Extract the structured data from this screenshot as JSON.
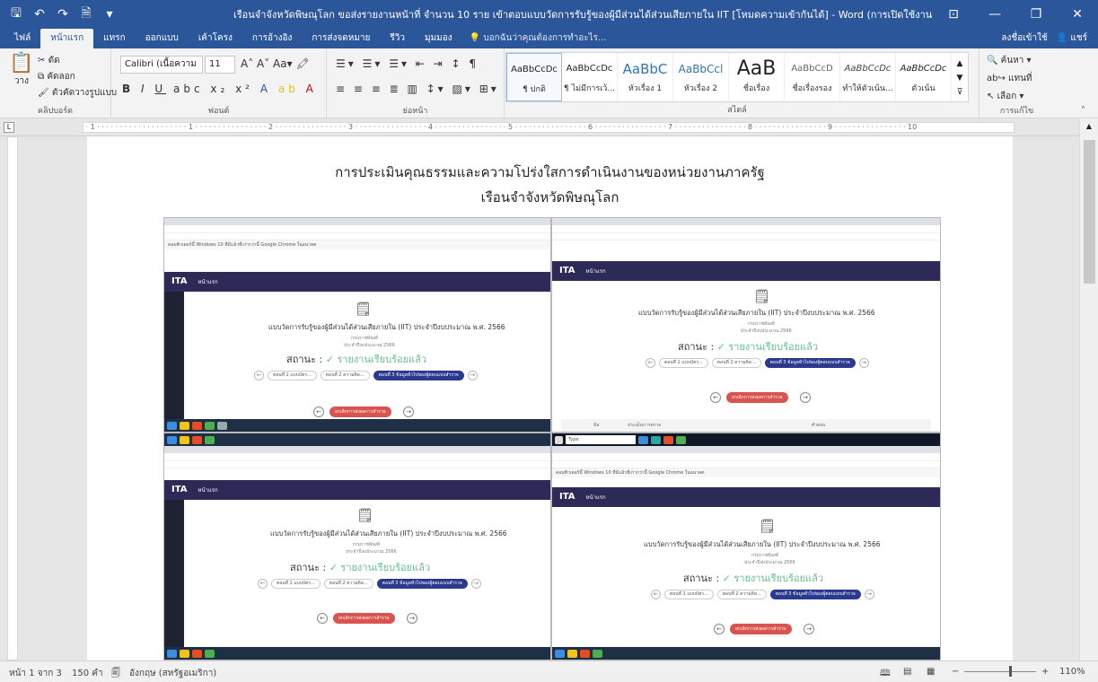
{
  "window": {
    "title": "เรือนจำจังหวัดพิษณุโลก ขอส่งรายงานหน้าที่ จำนวน 10 ราย เข้าตอบแบบวัดการรับรู้ของผู้มีส่วนได้ส่วนเสียภายใน IIT [โหมดความเข้ากันได้] - Word (การเปิดใช้งานผลิตภัณฑ์ล้มเหลว)",
    "minimize": "—",
    "restore": "❐",
    "close": "✕",
    "save_icon": "🖫",
    "undo_icon": "↶",
    "redo_icon": "↷",
    "print_icon": "🗎",
    "more_icon": "▾"
  },
  "tabs": [
    "ไฟล์",
    "หน้าแรก",
    "แทรก",
    "ออกแบบ",
    "เค้าโครง",
    "การอ้างอิง",
    "การส่งจดหมาย",
    "รีวิว",
    "มุมมอง"
  ],
  "tell_me": "บอกฉันว่าคุณต้องการทำอะไร...",
  "signin": "ลงชื่อเข้าใช้",
  "share": "แชร์",
  "ribbon": {
    "clipboard": {
      "label": "คลิปบอร์ด",
      "paste": "วาง",
      "cut": "ตัด",
      "copy": "คัดลอก",
      "format_painter": "ตัวคัดวางรูปแบบ"
    },
    "font": {
      "label": "ฟอนต์",
      "name": "Calibri (เนื้อความ",
      "size": "11"
    },
    "paragraph": {
      "label": "ย่อหน้า"
    },
    "styles": {
      "label": "สไตล์",
      "items": [
        {
          "sample": "AaBbCcDc",
          "name": "¶ ปกติ"
        },
        {
          "sample": "AaBbCcDc",
          "name": "¶ ไม่มีการเว้..."
        },
        {
          "sample": "AaBbC",
          "name": "หัวเรื่อง 1"
        },
        {
          "sample": "AaBbCcl",
          "name": "หัวเรื่อง 2"
        },
        {
          "sample": "AaB",
          "name": "ชื่อเรื่อง"
        },
        {
          "sample": "AaBbCcD",
          "name": "ชื่อเรื่องรอง"
        },
        {
          "sample": "AaBbCcDc",
          "name": "ทำให้ตัวเน้น..."
        },
        {
          "sample": "AaBbCcDc",
          "name": "ตัวเน้น"
        }
      ]
    },
    "editing": {
      "label": "การแก้ไข",
      "find": "ค้นหา",
      "replace": "แทนที่",
      "select": "เลือก"
    }
  },
  "document": {
    "heading_1": "การประเมินคุณธรรมและความโปร่งใสการดำเนินงานของหน่วยงานภาครัฐ",
    "heading_2": "เรือนจำจังหวัดพิษณุโลก"
  },
  "screenshot_content": {
    "nav_logo": "ITA",
    "nav_menu": "หน้าแรก",
    "survey_title": "แบบวัดการรับรู้ของผู้มีส่วนได้ส่วนเสียภายใน (IIT) ประจำปีงบประมาณ พ.ศ. 2566",
    "sub1": "กรมราชทัณฑ์",
    "sub2": "ประจำปีงบประมาณ 2566",
    "status_label": "สถานะ :",
    "status_value": "✓ รายงานเรียบร้อยแล้ว",
    "steps": [
      "ตอนที่ 1 แบบบัตร...",
      "ตอนที่ 2 ความคิด...",
      "ตอนที่ 3 ข้อมูลทั่วไปของผู้ตอบแบบสำรวจ"
    ],
    "submit": "ยกเลิกการส่งผลการสำรวจ",
    "browser_notice": "คอมพิวเตอร์นี้ Windows 10 ที่มีแล้วที่เก่ากว่านี้ Google Chrome ในอนาคต",
    "table_col1": "ข้อ",
    "table_col2": "ประเด็นการตรวจ",
    "table_col3": "คำตอบ",
    "search": "Type here to search"
  },
  "statusbar": {
    "page": "หน้า 1 จาก 3",
    "words": "150 คำ",
    "language": "อังกฤษ (สหรัฐอเมริกา)",
    "zoom": "110%"
  }
}
